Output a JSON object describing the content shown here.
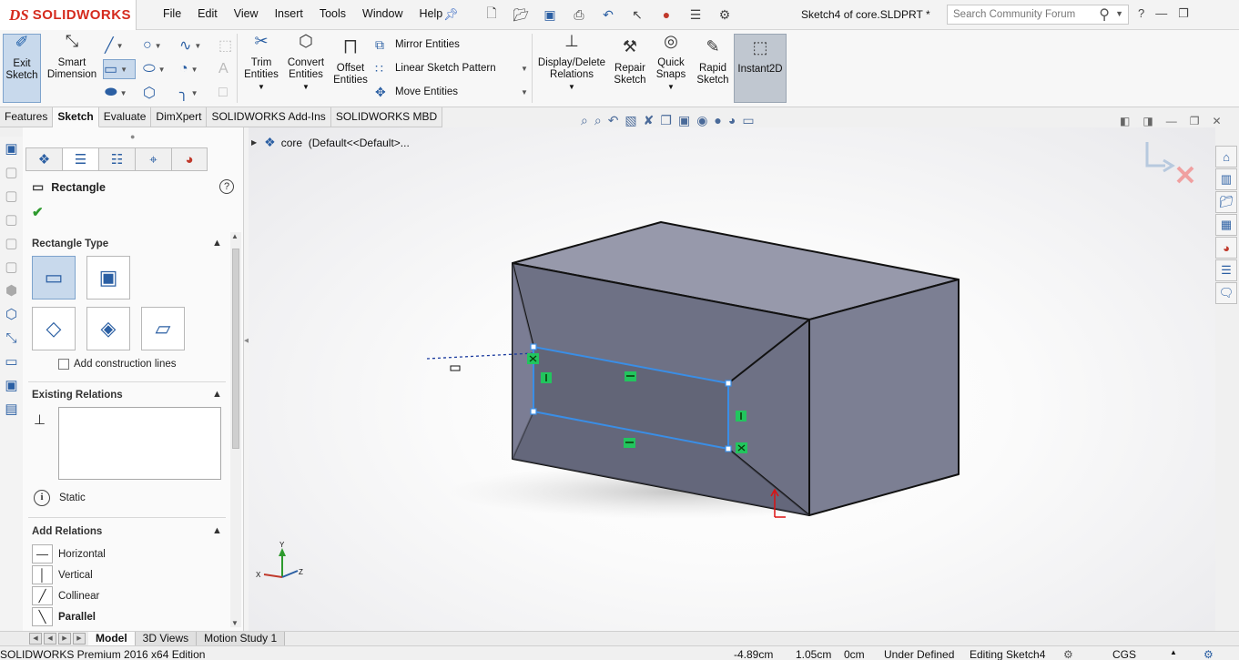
{
  "app": {
    "brand": "SOLIDWORKS",
    "ds": "DS",
    "doc_title": "Sketch4 of core.SLDPRT *"
  },
  "menu": [
    "File",
    "Edit",
    "View",
    "Insert",
    "Tools",
    "Window",
    "Help"
  ],
  "search": {
    "placeholder": "Search Community Forum"
  },
  "ribbon": {
    "exit_sketch": [
      "Exit",
      "Sketch"
    ],
    "smart_dimension": [
      "Smart",
      "Dimension"
    ],
    "trim": [
      "Trim",
      "Entities"
    ],
    "convert": [
      "Convert",
      "Entities"
    ],
    "offset": [
      "Offset",
      "Entities"
    ],
    "mirror": "Mirror Entities",
    "linear_pattern": "Linear Sketch Pattern",
    "move": "Move Entities",
    "display_delete": [
      "Display/Delete",
      "Relations"
    ],
    "repair": [
      "Repair",
      "Sketch"
    ],
    "quick_snaps": [
      "Quick",
      "Snaps"
    ],
    "rapid": [
      "Rapid",
      "Sketch"
    ],
    "instant2d": "Instant2D"
  },
  "tabs": [
    {
      "label": "Features",
      "active": false
    },
    {
      "label": "Sketch",
      "active": true
    },
    {
      "label": "Evaluate",
      "active": false
    },
    {
      "label": "DimXpert",
      "active": false
    },
    {
      "label": "SOLIDWORKS Add-Ins",
      "active": false
    },
    {
      "label": "SOLIDWORKS MBD",
      "active": false
    }
  ],
  "property_manager": {
    "title": "Rectangle",
    "rect_type_title": "Rectangle Type",
    "construction_lines": "Add construction lines",
    "existing_relations_title": "Existing Relations",
    "status": "Static",
    "add_relations_title": "Add Relations",
    "add_relations": [
      "Horizontal",
      "Vertical",
      "Collinear",
      "Parallel"
    ]
  },
  "tree": {
    "part": "core",
    "config": "(Default<<Default>..."
  },
  "bottom_tabs": [
    {
      "label": "Model",
      "active": true
    },
    {
      "label": "3D Views",
      "active": false
    },
    {
      "label": "Motion Study 1",
      "active": false
    }
  ],
  "status": {
    "edition": "SOLIDWORKS Premium 2016 x64 Edition",
    "x": "-4.89cm",
    "y": "1.05cm",
    "z": "0cm",
    "definition": "Under Defined",
    "editing": "Editing Sketch4",
    "units": "CGS"
  },
  "colors": {
    "accent": "#2b5fa3",
    "sketch_line": "#3a8ee6",
    "relation_glyph": "#22c55e",
    "brand_red": "#d52b1e",
    "box_top": "#9799ab",
    "box_right": "#7c7f93",
    "box_front": "#6e7185"
  }
}
